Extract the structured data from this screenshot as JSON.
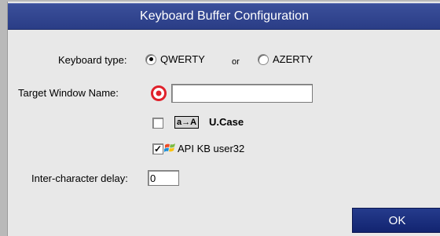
{
  "dialog": {
    "title": "Keyboard Buffer Configuration",
    "keyboard_type": {
      "label": "Keyboard type:",
      "options": [
        {
          "label": "QWERTY",
          "selected": true
        },
        {
          "label": "AZERTY",
          "selected": false
        }
      ],
      "separator": "or"
    },
    "target_window": {
      "label": "Target Window Name:",
      "value": "",
      "icon": "target-icon"
    },
    "ucase": {
      "checked": false,
      "icon_text": "a→A",
      "label": "U.Case"
    },
    "api_kb": {
      "checked": true,
      "icon": "windows-logo-icon",
      "label": "API KB user32"
    },
    "inter_char_delay": {
      "label": "Inter-character delay:",
      "value": "0"
    },
    "ok_label": "OK",
    "colors": {
      "title_bar": "#2f4290",
      "dialog_bg": "#e8e8e8",
      "ok_button": "#1b2d7c",
      "target_red": "#e0202a"
    }
  }
}
